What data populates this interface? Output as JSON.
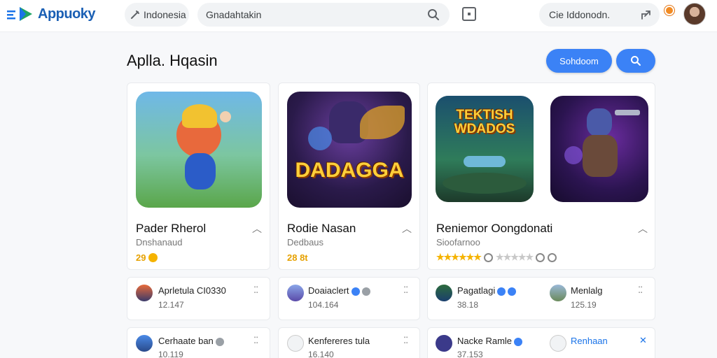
{
  "app": {
    "logo_text": "Appuoky"
  },
  "topbar": {
    "region_label": "Indonesia",
    "search_placeholder": "Gnadahtakin",
    "location_label": "Cie Iddonodn."
  },
  "heading": {
    "title": "Aplla. Hqasin",
    "primary_button": "Sohdoom"
  },
  "featured": [
    {
      "name": "Pader Rherol",
      "developer": "Dnshanaud",
      "rating": "29"
    },
    {
      "name": "Rodie Nasan",
      "developer": "Dedbaus",
      "rating": "28 8t",
      "thumb_title": "DADAGGA"
    },
    {
      "name": "Reniemor Oongdonati",
      "developer": "Sioofarnoo",
      "thumb_title": "TEKTISH WDADOS"
    }
  ],
  "list": [
    {
      "name": "Aprletula CI0330",
      "meta": "12.147"
    },
    {
      "name": "Doaiaclert",
      "meta": "104.164"
    },
    {
      "name": "Pagatlagi",
      "meta": "38.18"
    },
    {
      "name": "Menlalg",
      "meta": "125.19"
    },
    {
      "name": "Cerhaate ban",
      "meta": "10.119"
    },
    {
      "name": "Kenfereres tula",
      "meta": "16.140"
    },
    {
      "name": "Nacke Ramle",
      "meta": "37.153"
    },
    {
      "name": "Renhaan",
      "meta": ""
    }
  ],
  "colors": {
    "accent": "#3b82f6",
    "brand": "#1a5fb4",
    "star": "#f5b300"
  },
  "icons": [
    "menu-icon",
    "play-icon",
    "tool-icon",
    "search-icon",
    "square-icon",
    "share-icon",
    "bell-icon",
    "chevron-up-icon",
    "more-icon",
    "verified-icon"
  ]
}
